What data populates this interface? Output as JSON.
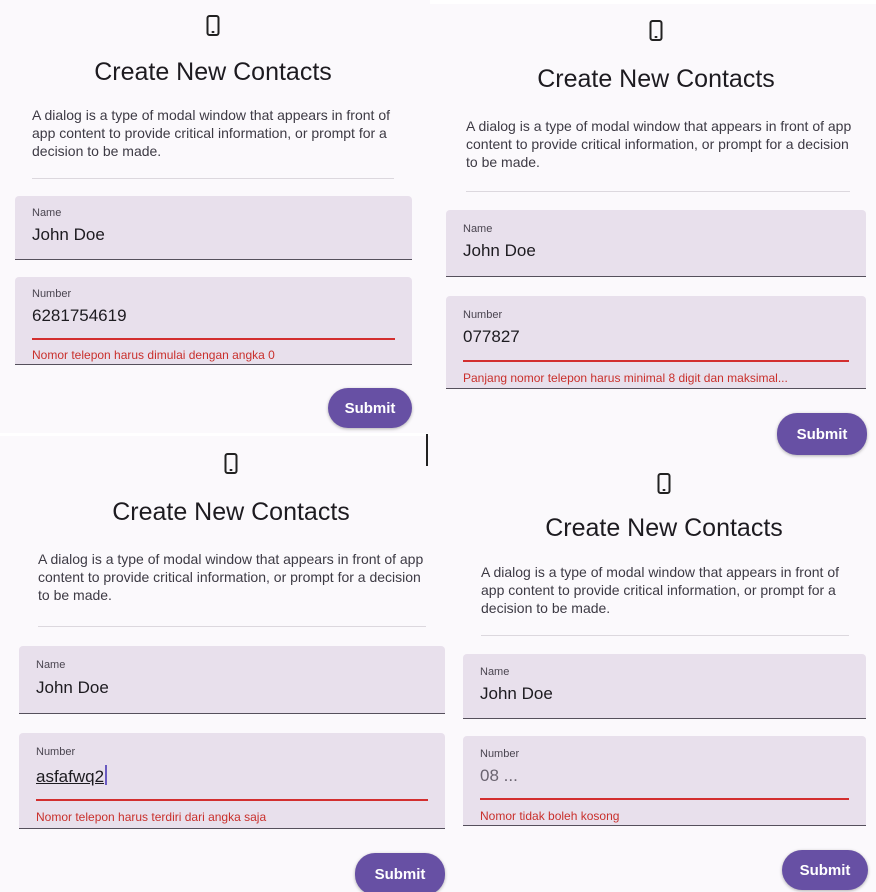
{
  "colors": {
    "accent": "#6750a4",
    "error": "#d32f2f",
    "field_bg": "#e8e0ec"
  },
  "panels": [
    {
      "icon": "smartphone-icon",
      "title": "Create New Contacts",
      "description": "A dialog is a type of modal window that appears in front of app content to provide critical information, or prompt for a decision to be made.",
      "name_field": {
        "label": "Name",
        "value": "John Doe"
      },
      "number_field": {
        "label": "Number",
        "value": "6281754619",
        "error": "Nomor telepon harus dimulai dengan angka 0"
      },
      "submit_label": "Submit"
    },
    {
      "icon": "smartphone-icon",
      "title": "Create New Contacts",
      "description": "A dialog is a type of modal window that appears in front of app content to provide critical information, or prompt for a decision to be made.",
      "name_field": {
        "label": "Name",
        "value": "John Doe"
      },
      "number_field": {
        "label": "Number",
        "value": "077827",
        "error": "Panjang nomor telepon harus minimal 8 digit dan maksimal..."
      },
      "submit_label": "Submit"
    },
    {
      "icon": "smartphone-icon",
      "title": "Create New Contacts",
      "description": "A dialog is a type of modal window that appears in front of app content to provide critical information, or prompt for a decision to be made.",
      "name_field": {
        "label": "Name",
        "value": "John Doe"
      },
      "number_field": {
        "label": "Number",
        "value": "asfafwq2",
        "error": "Nomor telepon harus terdiri dari angka saja"
      },
      "submit_label": "Submit"
    },
    {
      "icon": "smartphone-icon",
      "title": "Create New Contacts",
      "description": "A dialog is a type of modal window that appears in front of app content to provide critical information, or prompt for a decision to be made.",
      "name_field": {
        "label": "Name",
        "value": "John Doe"
      },
      "number_field": {
        "label": "Number",
        "placeholder": "08 ...",
        "error": "Nomor tidak boleh kosong"
      },
      "submit_label": "Submit"
    }
  ]
}
